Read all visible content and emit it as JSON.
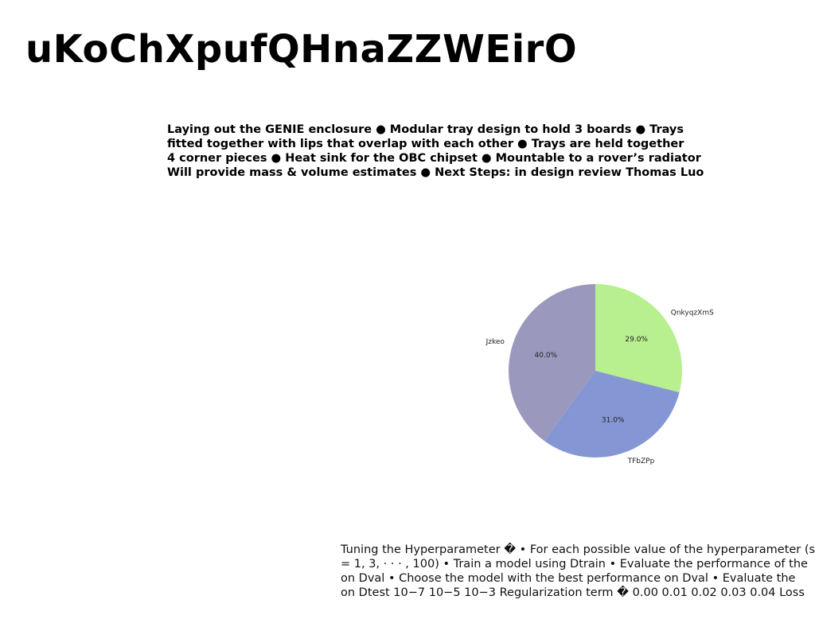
{
  "title": "uKoChXpufQHnaZZWEirO",
  "text_block_1": {
    "lines": [
      "Laying out the GENIE enclosure ● Modular tray design to hold 3 boards ● Trays",
      "fitted together with lips that overlap with each other ● Trays are held together",
      "4 corner pieces ● Heat sink for the OBC chipset ● Mountable to a rover’s radiator",
      "Will provide mass & volume estimates ● Next Steps: in design review Thomas Luo"
    ]
  },
  "text_block_2": {
    "lines": [
      "Tuning the Hyperparameter � • For each possible value of the hyperparameter (say",
      "= 1, 3, · · · , 100) • Train a model using Dtrain • Evaluate the performance of the",
      "on Dval • Choose the model with the best performance on Dval • Evaluate the",
      "on Dtest 10−7 10−5 10−3 Regularization term � 0.00 0.01 0.02 0.03 0.04 Loss"
    ]
  },
  "chart_data": {
    "type": "pie",
    "start_angle_deg": 90,
    "direction": "clockwise",
    "slices": [
      {
        "label": "QnkyqzXmS",
        "value": 29.0,
        "pct_label": "29.0%",
        "color": "#b8ef8f"
      },
      {
        "label": "TFbZPp",
        "value": 31.0,
        "pct_label": "31.0%",
        "color": "#8596d4"
      },
      {
        "label": "Jzkeo",
        "value": 40.0,
        "pct_label": "40.0%",
        "color": "#9b98bd"
      }
    ]
  }
}
